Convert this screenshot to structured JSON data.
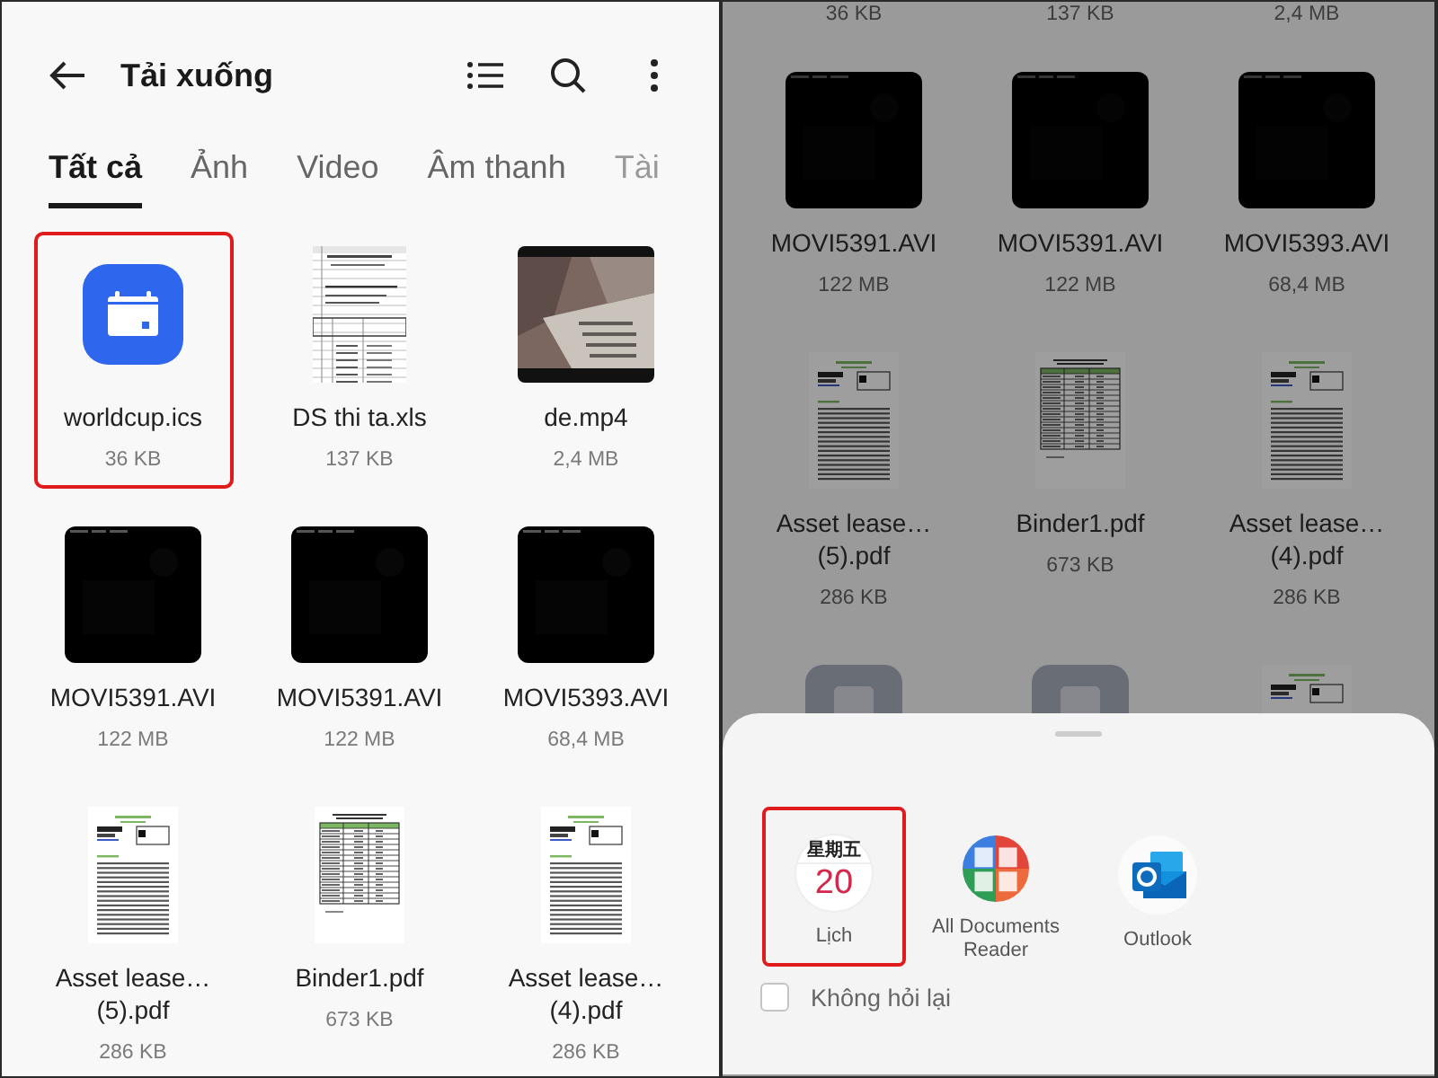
{
  "left_panel": {
    "header": {
      "title": "Tải xuống"
    },
    "tabs": [
      {
        "label": "Tất cả",
        "selected": true
      },
      {
        "label": "Ảnh",
        "selected": false
      },
      {
        "label": "Video",
        "selected": false
      },
      {
        "label": "Âm thanh",
        "selected": false
      },
      {
        "label": "Tài",
        "selected": false
      }
    ],
    "files": [
      {
        "kind": "calendar",
        "name": "worldcup.ics",
        "size": "36 KB",
        "highlighted": true
      },
      {
        "kind": "spreadsheet",
        "name": "DS thi ta.xls",
        "size": "137 KB",
        "highlighted": false
      },
      {
        "kind": "photo-video",
        "name": "de.mp4",
        "size": "2,4 MB",
        "highlighted": false
      },
      {
        "kind": "dark-video",
        "name": "MOVI5391.AVI",
        "size": "122 MB",
        "highlighted": false
      },
      {
        "kind": "dark-video",
        "name": "MOVI5391.AVI",
        "size": "122 MB",
        "highlighted": false
      },
      {
        "kind": "dark-video",
        "name": "MOVI5393.AVI",
        "size": "68,4 MB",
        "highlighted": false
      },
      {
        "kind": "pdf-form",
        "name": "Asset lease…\n(5).pdf",
        "size": "286 KB",
        "highlighted": false
      },
      {
        "kind": "pdf-table",
        "name": "Binder1.pdf",
        "size": "673 KB",
        "highlighted": false
      },
      {
        "kind": "pdf-form",
        "name": "Asset lease…\n(4).pdf",
        "size": "286 KB",
        "highlighted": false
      }
    ]
  },
  "right_panel": {
    "top_sizes": [
      "36 KB",
      "137 KB",
      "2,4 MB"
    ],
    "files": [
      {
        "kind": "dark-video",
        "name": "MOVI5391.AVI",
        "size": "122 MB",
        "highlighted": false
      },
      {
        "kind": "dark-video",
        "name": "MOVI5391.AVI",
        "size": "122 MB",
        "highlighted": false
      },
      {
        "kind": "dark-video",
        "name": "MOVI5393.AVI",
        "size": "68,4 MB",
        "highlighted": false
      },
      {
        "kind": "pdf-form",
        "name": "Asset lease…\n(5).pdf",
        "size": "286 KB",
        "highlighted": false
      },
      {
        "kind": "pdf-table",
        "name": "Binder1.pdf",
        "size": "673 KB",
        "highlighted": false
      },
      {
        "kind": "pdf-form",
        "name": "Asset lease…\n(4).pdf",
        "size": "286 KB",
        "highlighted": false
      },
      {
        "kind": "generic-file",
        "highlighted": false
      },
      {
        "kind": "generic-file",
        "highlighted": false
      },
      {
        "kind": "pdf-form",
        "highlighted": false
      }
    ],
    "open_with_sheet": {
      "apps": [
        {
          "kind": "calendar",
          "weekday": "星期五",
          "day": "20",
          "label": "Lịch",
          "highlighted": true
        },
        {
          "kind": "documents",
          "label": "All Documents\nReader",
          "highlighted": false
        },
        {
          "kind": "outlook",
          "label": "Outlook",
          "highlighted": false
        }
      ],
      "remember_choice": {
        "label": "Không hỏi lại",
        "checked": false
      }
    }
  }
}
